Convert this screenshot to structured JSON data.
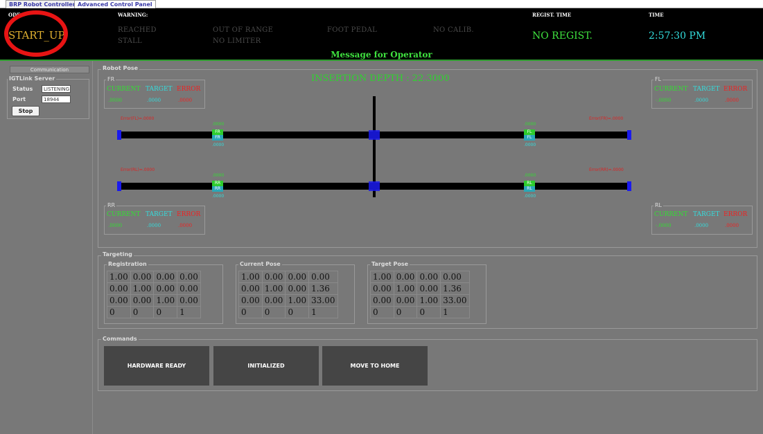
{
  "tabs": [
    "BRP Robot Controller",
    "Advanced Control Panel"
  ],
  "status": {
    "mode_label": "ODE:",
    "mode_value": "START_UP",
    "warning_label": "WARNING:",
    "warnings_row1": [
      "REACHED",
      "OUT OF RANGE",
      "FOOT PEDAL",
      "NO CALIB."
    ],
    "warnings_row2": [
      "STALL",
      "NO LIMITER"
    ],
    "regist_label": "REGIST. TIME",
    "regist_value": "NO REGIST.",
    "time_label": "TIME",
    "time_value": "2:57:30 PM",
    "message_title": "Message for Operator"
  },
  "colors": {
    "mode": "#e0b030",
    "regist": "#3fe23f",
    "time": "#33dddd",
    "annotation_ring": "#e81414"
  },
  "communication": {
    "header": "Communication",
    "group_title": "IGTLink Server",
    "status_label": "Status",
    "status_value": "LISTENING",
    "port_label": "Port",
    "port_value": "18944",
    "stop_label": "Stop"
  },
  "robot_pose": {
    "title": "Robot Pose",
    "insertion_depth": "INSERTION DEPTH : 22.3000",
    "col_labels": [
      "CURRENT",
      "TARGET",
      "ERROR"
    ],
    "boxes": {
      "fr": {
        "name": "FR",
        "current": ".0000",
        "target": ".0000",
        "error": ".0000"
      },
      "fl": {
        "name": "FL",
        "current": "-.0000",
        "target": ".0000",
        "error": ".0000"
      },
      "rr": {
        "name": "RR",
        "current": ".0000",
        "target": ".0000",
        "error": ".0000"
      },
      "rl": {
        "name": "RL",
        "current": "-.0000",
        "target": ".0000",
        "error": ".0000"
      }
    },
    "rails": {
      "front": {
        "err_left": "Error(FL)=.0000",
        "err_right": "Error(FR)=.0000",
        "left_marker": {
          "top": "FR",
          "bottom": "FR",
          "above": ".0000",
          "below": ".0000"
        },
        "right_marker": {
          "top": "FL",
          "bottom": "FL",
          "above": ".0000",
          "below": ".0000"
        }
      },
      "rear": {
        "err_left": "Error(RL)=.0000",
        "err_right": "Error(RR)=.0000",
        "left_marker": {
          "top": "RR",
          "bottom": "RR",
          "above": ".0000",
          "below": ".0000"
        },
        "right_marker": {
          "top": "RL",
          "bottom": "RL",
          "above": ".0000",
          "below": ".0000"
        }
      }
    }
  },
  "targeting": {
    "title": "Targeting",
    "registration": {
      "title": "Registration",
      "rows": [
        [
          "1.00",
          "0.00",
          "0.00",
          "0.00"
        ],
        [
          "0.00",
          "1.00",
          "0.00",
          "0.00"
        ],
        [
          "0.00",
          "0.00",
          "1.00",
          "0.00"
        ],
        [
          "0",
          "0",
          "0",
          "1"
        ]
      ]
    },
    "current_pose": {
      "title": "Current Pose",
      "rows": [
        [
          "1.00",
          "0.00",
          "0.00",
          "0.00"
        ],
        [
          "0.00",
          "1.00",
          "0.00",
          "1.36"
        ],
        [
          "0.00",
          "0.00",
          "1.00",
          "33.00"
        ],
        [
          "0",
          "0",
          "0",
          "1"
        ]
      ]
    },
    "target_pose": {
      "title": "Target Pose",
      "rows": [
        [
          "1.00",
          "0.00",
          "0.00",
          "0.00"
        ],
        [
          "0.00",
          "1.00",
          "0.00",
          "1.36"
        ],
        [
          "0.00",
          "0.00",
          "1.00",
          "33.00"
        ],
        [
          "0",
          "0",
          "0",
          "1"
        ]
      ]
    }
  },
  "commands": {
    "title": "Commands",
    "buttons": [
      "HARDWARE READY",
      "INITIALIZED",
      "MOVE TO HOME"
    ]
  }
}
